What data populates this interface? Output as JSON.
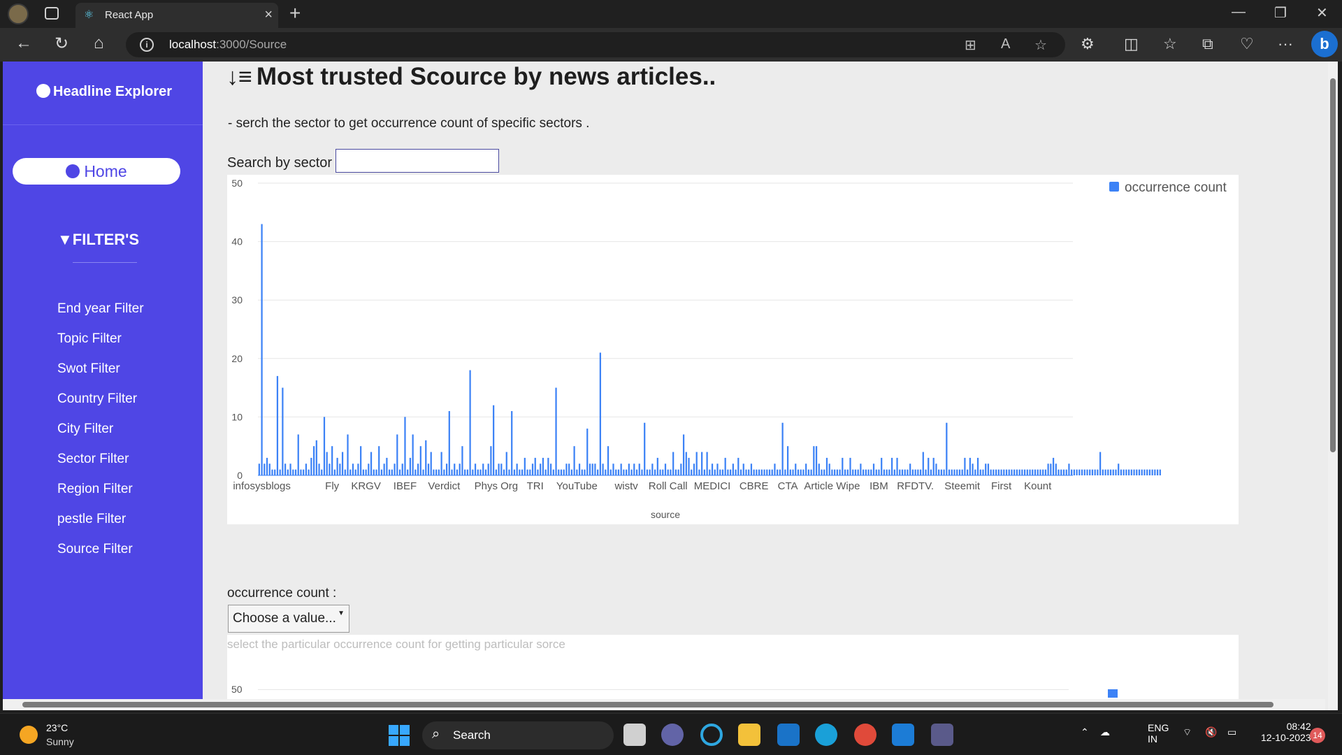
{
  "browser": {
    "tab_title": "React App",
    "url_host": "localhost",
    "url_path": ":3000/Source"
  },
  "sidebar": {
    "brand": "Headline Explorer",
    "home_label": "Home",
    "filters_title": "FILTER'S",
    "items": [
      {
        "label": "End year Filter"
      },
      {
        "label": "Topic Filter"
      },
      {
        "label": "Swot Filter"
      },
      {
        "label": "Country Filter"
      },
      {
        "label": "City Filter"
      },
      {
        "label": "Sector Filter"
      },
      {
        "label": "Region Filter"
      },
      {
        "label": "pestle Filter"
      },
      {
        "label": "Source Filter"
      }
    ]
  },
  "main": {
    "title": "Most trusted Scource by news articles..",
    "subtitle": "- serch the sector to get occurrence count of specific sectors .",
    "search_label": "Search by sector",
    "search_value": "",
    "occurrence_label": "occurrence count :",
    "select_value": "Choose a value...",
    "hint": "select the particular occurrence count for getting particular sorce",
    "chart2_y_top": "50"
  },
  "chart_data": {
    "type": "bar",
    "xlabel": "source",
    "ylabel": "",
    "ylim": [
      0,
      50
    ],
    "yticks": [
      0,
      10,
      20,
      30,
      40,
      50
    ],
    "legend": "occurrence count",
    "legend_position": "top-right",
    "grid": true,
    "color": "#3c82f6",
    "tick_labels": [
      {
        "label": "infosysblogs",
        "index": 1
      },
      {
        "label": "Fly",
        "index": 28
      },
      {
        "label": "KRGV",
        "index": 41
      },
      {
        "label": "IBEF",
        "index": 56
      },
      {
        "label": "Verdict",
        "index": 71
      },
      {
        "label": "Phys Org",
        "index": 91
      },
      {
        "label": "TRI",
        "index": 106
      },
      {
        "label": "YouTube",
        "index": 122
      },
      {
        "label": "wistv",
        "index": 141
      },
      {
        "label": "Roll Call",
        "index": 157
      },
      {
        "label": "MEDICI",
        "index": 174
      },
      {
        "label": "CBRE",
        "index": 190
      },
      {
        "label": "CTA",
        "index": 203
      },
      {
        "label": "Article Wipe",
        "index": 220
      },
      {
        "label": "IBM",
        "index": 238
      },
      {
        "label": "RFDTV.",
        "index": 252
      },
      {
        "label": "Steemit",
        "index": 270
      },
      {
        "label": "First",
        "index": 285
      },
      {
        "label": "Kount",
        "index": 299
      }
    ],
    "n_categories": 313,
    "values": [
      2,
      43,
      2,
      3,
      2,
      1,
      1,
      17,
      1,
      15,
      2,
      1,
      2,
      1,
      1,
      7,
      1,
      1,
      2,
      1,
      3,
      5,
      6,
      2,
      1,
      10,
      4,
      2,
      5,
      1,
      3,
      2,
      4,
      1,
      7,
      1,
      2,
      1,
      2,
      5,
      1,
      1,
      2,
      4,
      1,
      1,
      5,
      1,
      2,
      3,
      1,
      1,
      2,
      7,
      1,
      2,
      10,
      1,
      3,
      7,
      1,
      2,
      5,
      1,
      6,
      2,
      4,
      1,
      1,
      1,
      4,
      1,
      2,
      11,
      1,
      2,
      1,
      2,
      5,
      1,
      1,
      18,
      1,
      2,
      1,
      1,
      2,
      1,
      2,
      5,
      12,
      1,
      2,
      2,
      1,
      4,
      1,
      11,
      1,
      2,
      1,
      1,
      3,
      1,
      1,
      2,
      3,
      1,
      2,
      3,
      1,
      3,
      2,
      1,
      15,
      1,
      1,
      1,
      2,
      2,
      1,
      5,
      1,
      2,
      1,
      1,
      8,
      2,
      2,
      2,
      1,
      21,
      2,
      1,
      5,
      1,
      2,
      1,
      1,
      2,
      1,
      1,
      2,
      1,
      2,
      1,
      2,
      1,
      9,
      1,
      1,
      2,
      1,
      3,
      1,
      1,
      2,
      1,
      1,
      4,
      1,
      1,
      2,
      7,
      4,
      3,
      1,
      2,
      4,
      1,
      4,
      1,
      4,
      1,
      2,
      1,
      2,
      1,
      1,
      3,
      1,
      1,
      2,
      1,
      3,
      1,
      2,
      1,
      1,
      2,
      1,
      1,
      1,
      1,
      1,
      1,
      1,
      1,
      2,
      1,
      1,
      9,
      1,
      5,
      1,
      1,
      2,
      1,
      1,
      1,
      2,
      1,
      1,
      5,
      5,
      2,
      1,
      1,
      3,
      2,
      1,
      1,
      1,
      1,
      3,
      1,
      1,
      3,
      1,
      1,
      1,
      2,
      1,
      1,
      1,
      1,
      2,
      1,
      1,
      3,
      1,
      1,
      1,
      3,
      1,
      3,
      1,
      1,
      1,
      1,
      2,
      1,
      1,
      1,
      1,
      4,
      1,
      3,
      1,
      3,
      2,
      1,
      1,
      1,
      9,
      1,
      1,
      1,
      1,
      1,
      1,
      3,
      1,
      3,
      2,
      1,
      3,
      1,
      1,
      2,
      2,
      1,
      1,
      1,
      1,
      1,
      1,
      1,
      1,
      1,
      1,
      1,
      1,
      1,
      1,
      1,
      1,
      1,
      1,
      1,
      1,
      1,
      1,
      2,
      2,
      3,
      2,
      1,
      1,
      1,
      1,
      2,
      1,
      1,
      1,
      1,
      1,
      1,
      1,
      1,
      1,
      1,
      1,
      4,
      1,
      1,
      1,
      1,
      1,
      1,
      2,
      1,
      1,
      1,
      1,
      1,
      1,
      1,
      1,
      1,
      1,
      1,
      1,
      1,
      1,
      1,
      1
    ]
  }
}
